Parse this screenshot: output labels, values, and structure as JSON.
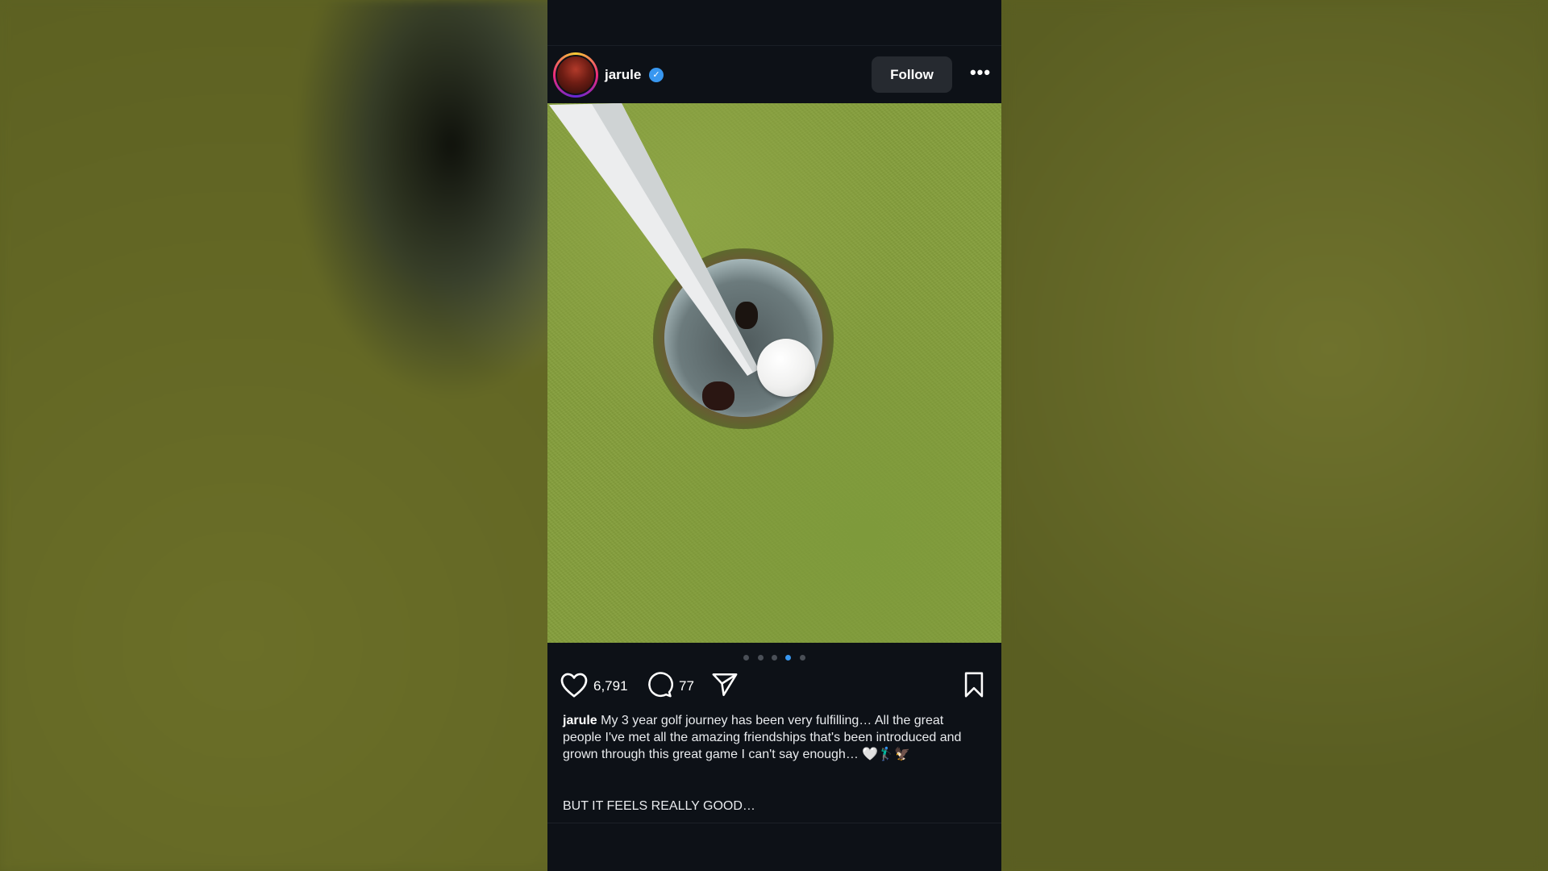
{
  "post": {
    "username": "jarule",
    "verified_icon": "verified-badge-icon",
    "follow_label": "Follow",
    "more_icon_glyph": "•••",
    "carousel": {
      "total": 5,
      "active_index": 3
    },
    "likes": "6,791",
    "comments": "77",
    "caption_user": "jarule",
    "caption_text": "My 3 year golf journey has been very fulfilling… All the great people I've met all the amazing friendships that's been introduced and grown through this great game I can't say enough… 🤍🏌🏾‍♂️🦅",
    "caption_extra": "BUT IT FEELS REALLY GOOD…"
  },
  "colors": {
    "panel_bg": "#0d1117",
    "accent_blue": "#3897f0",
    "follow_bg": "#262a30",
    "grass": "#86a03d"
  }
}
